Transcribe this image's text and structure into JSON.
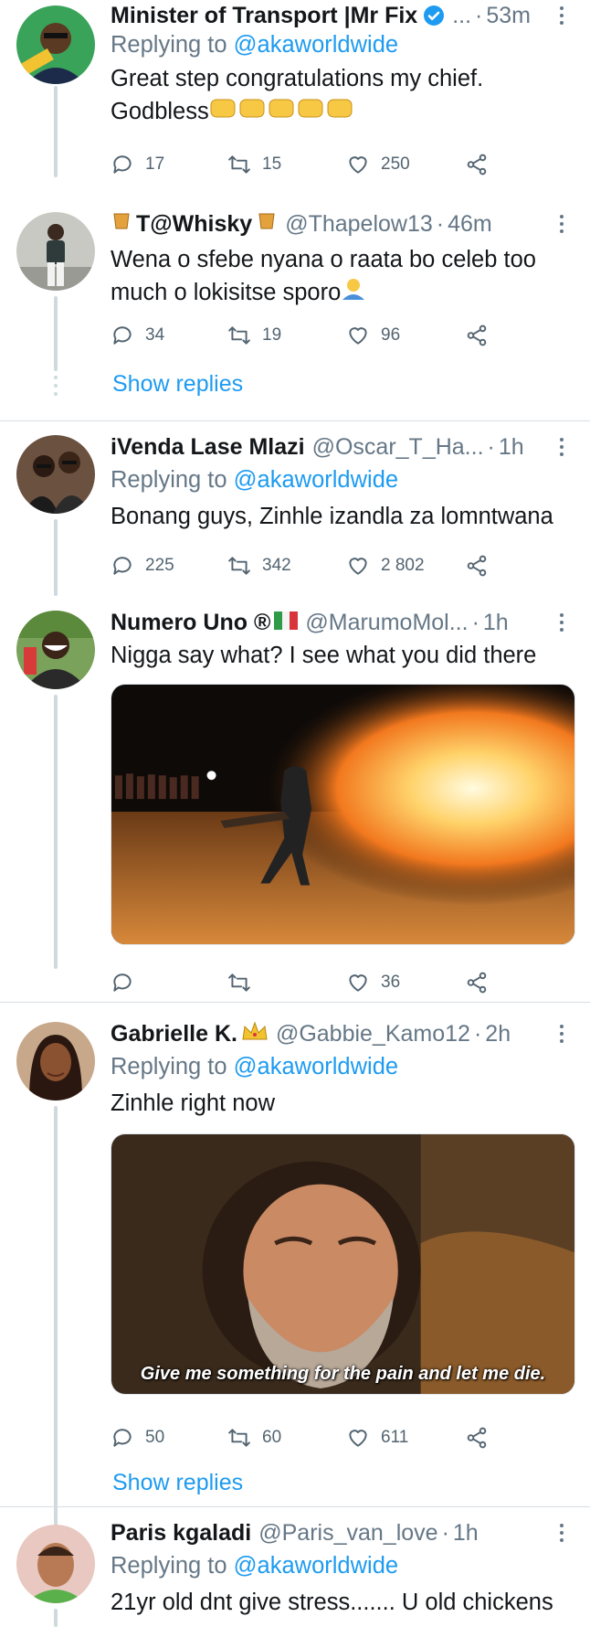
{
  "tweets": [
    {
      "name": "Minister of Transport |Mr Fix",
      "handle": "...",
      "time": "53m",
      "replying_label": "Replying to",
      "replying_handle": "@akaworldwide",
      "text_lines": [
        "Great step congratulations my chief.",
        "Godbless"
      ],
      "emojis": "fist-bump x5",
      "replies": "17",
      "retweets": "15",
      "likes": "250"
    },
    {
      "name": "T@Whisky",
      "handle": "@Thapelow13",
      "time": "46m",
      "text_lines": [
        "Wena o sfebe nyana o raata bo celeb too",
        "much o lokisitse sporo"
      ],
      "replies": "34",
      "retweets": "19",
      "likes": "96",
      "show_replies": "Show replies"
    },
    {
      "name": "iVenda Lase Mlazi",
      "handle": "@Oscar_T_Ha...",
      "time": "1h",
      "replying_label": "Replying to",
      "replying_handle": "@akaworldwide",
      "text_lines": [
        "Bonang guys, Zinhle izandla za lomntwana"
      ],
      "replies": "225",
      "retweets": "342",
      "likes": "2 802"
    },
    {
      "name": "Numero Uno ®",
      "handle": "@MarumoMol...",
      "time": "1h",
      "text_lines": [
        "Nigga say what? I see what you did there"
      ],
      "replies": "",
      "retweets": "",
      "likes": "36"
    },
    {
      "name": "Gabrielle K.",
      "handle": "@Gabbie_Kamo12",
      "time": "2h",
      "replying_label": "Replying to",
      "replying_handle": "@akaworldwide",
      "text_lines": [
        "Zinhle right now"
      ],
      "media_caption": "Give me something for the pain and let me die.",
      "replies": "50",
      "retweets": "60",
      "likes": "611",
      "show_replies": "Show replies"
    },
    {
      "name": "Paris kgaladi",
      "handle": "@Paris_van_love",
      "time": "1h",
      "replying_label": "Replying to",
      "replying_handle": "@akaworldwide",
      "text_lines": [
        "21yr old dnt give stress....... U old chickens"
      ]
    }
  ],
  "sep": "·",
  "colors": {
    "accent": "#1d9bf0",
    "secondary": "#657786",
    "thread": "#cfd9de"
  }
}
